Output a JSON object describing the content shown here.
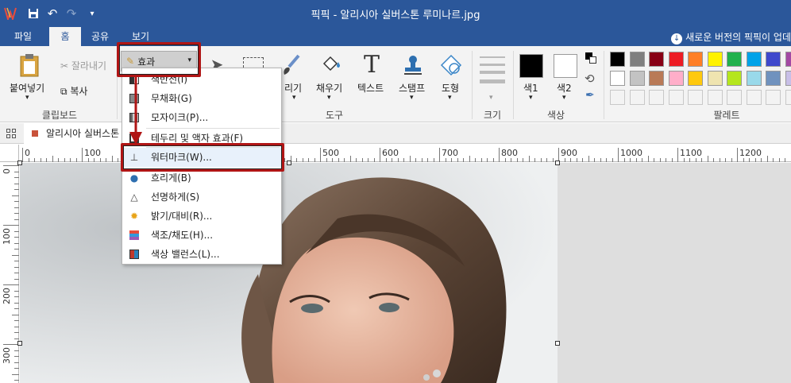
{
  "window": {
    "title": "픽픽 - 알리시아 실버스톤 루미나르.jpg",
    "update_notice": "새로운 버전의 픽픽이 업데"
  },
  "tabs": [
    {
      "label": "파일"
    },
    {
      "label": "홈"
    },
    {
      "label": "공유"
    },
    {
      "label": "보기"
    }
  ],
  "ribbon": {
    "clipboard": {
      "paste": "붙여넣기",
      "cut": "잘라내기",
      "copy": "복사",
      "group_label": "클립보드"
    },
    "effect_button": "효과",
    "tools": {
      "fill": "채우기",
      "text": "텍스트",
      "stamp": "스탬프",
      "shape": "도형",
      "partial_left": "리기",
      "group_label": "도구"
    },
    "size": {
      "group_label": "크기"
    },
    "color": {
      "color1": "색1",
      "color2": "색2",
      "group_label": "색상"
    },
    "palette": {
      "group_label": "팔레트"
    }
  },
  "palette_row1": [
    "#000000",
    "#7f7f7f",
    "#880015",
    "#ed1c24",
    "#ff7f27",
    "#fff200",
    "#22b14c",
    "#00a2e8",
    "#3f48cc",
    "#a349a4"
  ],
  "palette_row2": [
    "#ffffff",
    "#c3c3c3",
    "#b97a57",
    "#ffaec9",
    "#ffc90e",
    "#efe4b0",
    "#b5e61d",
    "#99d9ea",
    "#7092be",
    "#c8bfe7"
  ],
  "document_tab": "알리시아 실버스톤",
  "effects_menu": [
    {
      "label": "색반전(I)",
      "icon": "invert-icon"
    },
    {
      "label": "무채화(G)",
      "icon": "grayscale-icon"
    },
    {
      "label": "모자이크(P)...",
      "icon": "mosaic-icon"
    },
    {
      "label": "테두리 및 액자 효과(F)",
      "icon": "frame-icon"
    },
    {
      "label": "워터마크(W)...",
      "icon": "watermark-icon"
    },
    {
      "label": "흐리게(B)",
      "icon": "blur-icon"
    },
    {
      "label": "선명하게(S)",
      "icon": "sharpen-icon"
    },
    {
      "label": "밝기/대비(R)...",
      "icon": "brightness-icon"
    },
    {
      "label": "색조/채도(H)...",
      "icon": "hue-icon"
    },
    {
      "label": "색상 밸런스(L)...",
      "icon": "color-balance-icon"
    }
  ],
  "ruler_h": [
    "0",
    "100",
    "200",
    "300",
    "400",
    "500",
    "600",
    "700",
    "800",
    "900",
    "1000",
    "1100",
    "1200"
  ],
  "ruler_v": [
    "0",
    "100",
    "200",
    "300"
  ]
}
